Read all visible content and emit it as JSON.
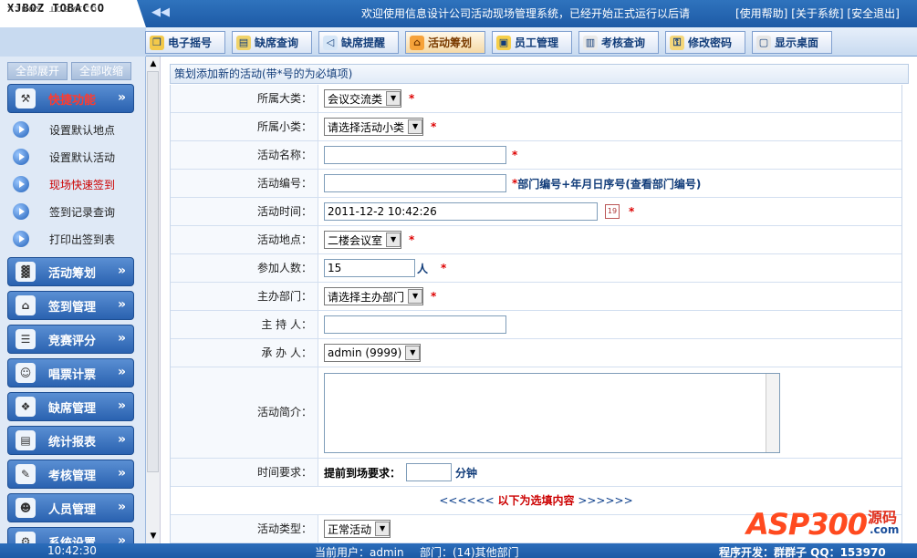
{
  "header": {
    "logo_line1": "XJBOZ TOBACCO",
    "logo_line2": "XJBOZ TOBACCO",
    "welcome": "欢迎使用信息设计公司活动现场管理系统，已经开始正式运行以后请",
    "links": [
      "[使用帮助]",
      "[关于系统]",
      "[安全退出]"
    ]
  },
  "tabs": [
    {
      "label": "电子摇号",
      "icon": "key-icon"
    },
    {
      "label": "缺席查询",
      "icon": "book-icon"
    },
    {
      "label": "缺席提醒",
      "icon": "speaker-icon"
    },
    {
      "label": "活动筹划",
      "icon": "house-icon",
      "active": true
    },
    {
      "label": "员工管理",
      "icon": "person-card-icon"
    },
    {
      "label": "考核查询",
      "icon": "clipboard-icon"
    },
    {
      "label": "修改密码",
      "icon": "keys-icon"
    },
    {
      "label": "显示桌面",
      "icon": "desktop-icon"
    }
  ],
  "sidebar": {
    "expand_all": "全部展开",
    "collapse_all": "全部收缩",
    "quick_label": "快捷功能",
    "quick_items": [
      "设置默认地点",
      "设置默认活动",
      "现场快速签到",
      "签到记录查询",
      "打印出签到表"
    ],
    "menus": [
      "活动筹划",
      "签到管理",
      "竞赛评分",
      "唱票计票",
      "缺席管理",
      "统计报表",
      "考核管理",
      "人员管理",
      "系统设置"
    ]
  },
  "form": {
    "header": "策划添加新的活动(带*号的为必填项)",
    "category_label": "所属大类：",
    "category_value": "会议交流类",
    "subcategory_label": "所属小类：",
    "subcategory_value": "请选择活动小类",
    "name_label": "活动名称：",
    "name_value": "",
    "code_label": "活动编号：",
    "code_value": "",
    "code_note": "部门编号+年月日序号(查看部门编号)",
    "time_label": "活动时间：",
    "time_value": "2011-12-2 10:42:26",
    "location_label": "活动地点：",
    "location_value": "二楼会议室",
    "count_label": "参加人数：",
    "count_value": "15",
    "count_unit": "人",
    "dept_label": "主办部门：",
    "dept_value": "请选择主办部门",
    "host_label": "主 持 人：",
    "host_value": "",
    "organizer_label": "承 办 人：",
    "organizer_value": "admin (9999)",
    "summary_label": "活动简介：",
    "summary_value": "",
    "timereq_label": "时间要求：",
    "arrive_label": "提前到场要求：",
    "arrive_value": "",
    "arrive_unit": "分钟",
    "optional_prefix": "<<<<<< ",
    "optional_text": "以下为选填内容",
    "optional_suffix": " >>>>>>",
    "type_label": "活动类型：",
    "type_value": "正常活动",
    "required_mark": "*"
  },
  "footer": {
    "time": "10:42:30",
    "user": "当前用户：admin",
    "dept": "部门：(14)其他部门",
    "dev": "程序开发：群群子 QQ：153970"
  },
  "watermark": {
    "brand": "ASP300",
    "cn": "源码",
    "com": ".com"
  }
}
